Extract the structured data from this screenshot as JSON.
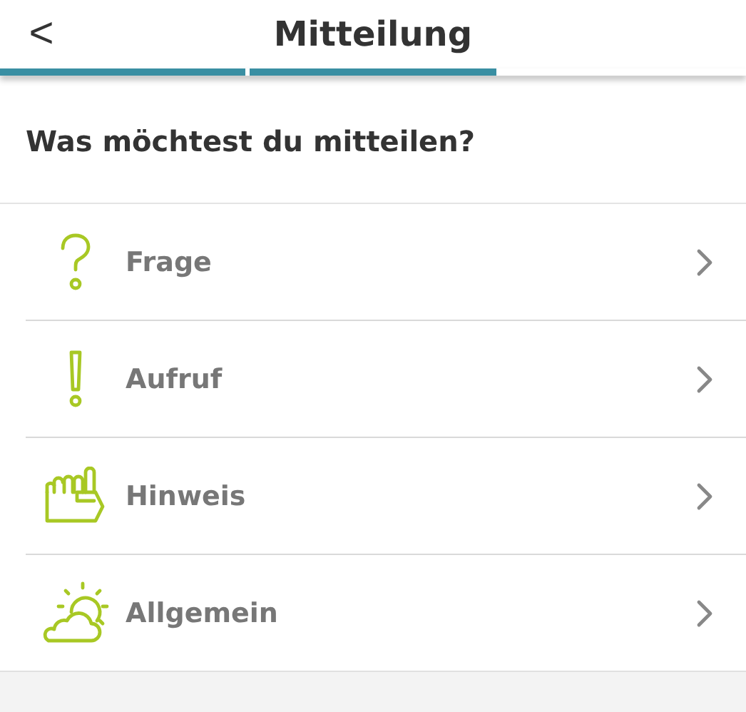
{
  "header": {
    "back": "<",
    "title": "Mitteilung"
  },
  "progress": [
    {
      "filled": true
    },
    {
      "filled": true
    },
    {
      "filled": false
    }
  ],
  "question": "Was möchtest du mitteilen?",
  "options": [
    {
      "kind": "question",
      "label": "Frage"
    },
    {
      "kind": "exclamation",
      "label": "Aufruf"
    },
    {
      "kind": "hand",
      "label": "Hinweis"
    },
    {
      "kind": "weather",
      "label": "Allgemein"
    }
  ]
}
